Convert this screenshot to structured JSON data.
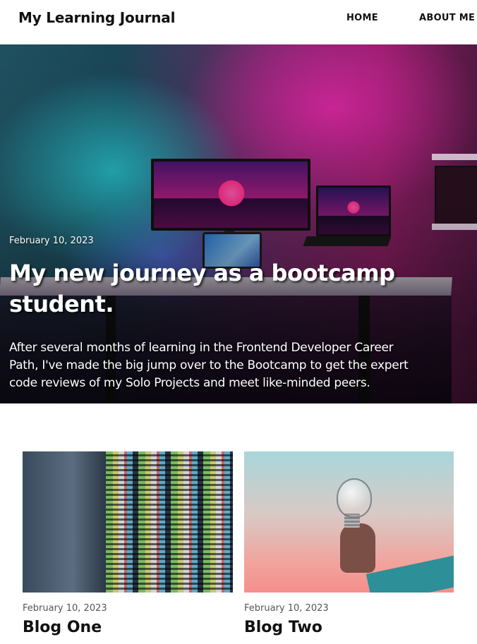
{
  "header": {
    "site_title": "My Learning Journal",
    "nav": {
      "home": "HOME",
      "about": "ABOUT ME"
    }
  },
  "hero": {
    "date": "February 10, 2023",
    "title": "My new journey as a bootcamp student.",
    "excerpt": "After several months of learning in the Frontend Developer Career Path, I've made the big jump over to the Bootcamp to get the expert code reviews of my Solo Projects and meet like-minded peers.",
    "image": "desk-setup-neon-lights"
  },
  "posts": [
    {
      "date": "February 10, 2023",
      "title": "Blog One",
      "image": "code-on-monitor"
    },
    {
      "date": "February 10, 2023",
      "title": "Blog Two",
      "image": "hand-holding-lightbulb"
    }
  ]
}
